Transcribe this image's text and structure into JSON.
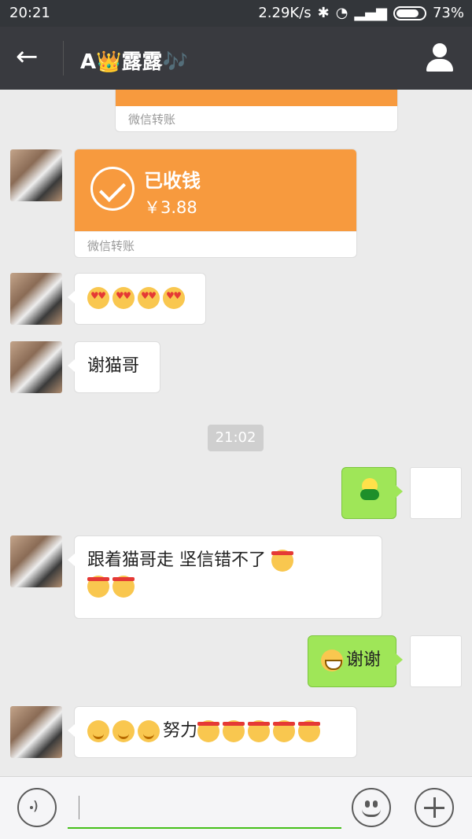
{
  "status_bar": {
    "time": "20:21",
    "speed": "2.29K/s",
    "battery": "73%"
  },
  "header": {
    "title": "A👑露露🎶"
  },
  "transfers": [
    {
      "footer": "微信转账"
    },
    {
      "status": "已收钱",
      "amount": "￥3.88",
      "footer": "微信转账"
    }
  ],
  "messages": {
    "thanks": "谢猫哥",
    "timestamp": "21:02",
    "follow": "跟着猫哥走   坚信错不了",
    "reply_thanks": "谢谢",
    "effort": "努力"
  },
  "colors": {
    "accent_green": "#9fe658",
    "transfer_orange": "#f79a3e",
    "topbar": "#393a3f"
  }
}
